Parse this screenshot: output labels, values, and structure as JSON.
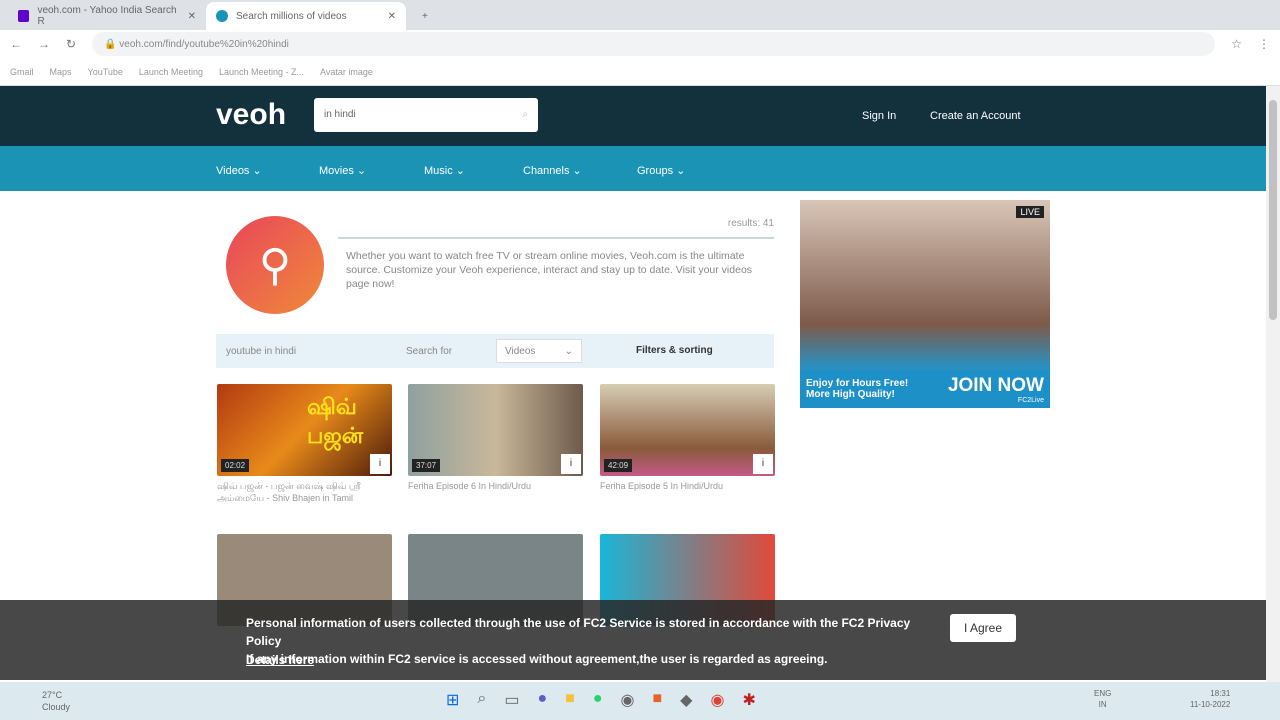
{
  "browser": {
    "tabs": [
      {
        "title": "veoh.com - Yahoo India Search R"
      },
      {
        "title": "Search millions of videos"
      }
    ],
    "url": "veoh.com/find/youtube%20in%20hindi",
    "bookmarks": [
      "Gmail",
      "Maps",
      "YouTube",
      "Launch Meeting",
      "Launch Meeting - Z...",
      "Avatar image"
    ]
  },
  "header": {
    "logo": "veoh",
    "search_value": "in hindi",
    "sign_in": "Sign In",
    "create_account": "Create an Account"
  },
  "nav": [
    "Videos",
    "Movies",
    "Music",
    "Channels",
    "Groups"
  ],
  "results": "results: 41",
  "description": "Whether you want to watch free TV or stream online movies, Veoh.com is the ultimate source. Customize your Veoh experience, interact and stay up to date. Visit your videos page now!",
  "filters": {
    "query": "youtube in hindi",
    "search_for_label": "Search for",
    "search_for_value": "Videos",
    "filters_label": "Filters & sorting"
  },
  "videos": [
    {
      "title": "ஷிவ் பஜன் - பஜன் வைஷ் ஷிவ் ஸ்ரீ அம்மையே - Shiv Bhajen in Tamil",
      "duration": "02:02",
      "thumb_text": "ஷிவ் பஜன்"
    },
    {
      "title": "Feriha Episode 6 In Hindi/Urdu",
      "duration": "37:07"
    },
    {
      "title": "Feriha Episode 5 In Hindi/Urdu",
      "duration": "42:09"
    }
  ],
  "ad": {
    "line1": "Enjoy for Hours Free!",
    "line2": "More High Quality!",
    "cta": "JOIN NOW",
    "badge": "LIVE",
    "brand": "FC2Live"
  },
  "cookie": {
    "text1": "Personal information of users collected through the use of FC2 Service is stored in accordance with the FC2 Privacy Policy",
    "text2": "If any information within FC2 service is accessed without agreement,the user is regarded as agreeing.",
    "details": "Details here",
    "agree": "I Agree"
  },
  "taskbar": {
    "temp": "27°C",
    "weather": "Cloudy",
    "lang1": "ENG",
    "lang2": "IN",
    "time": "18:31",
    "date": "11-10-2022"
  }
}
